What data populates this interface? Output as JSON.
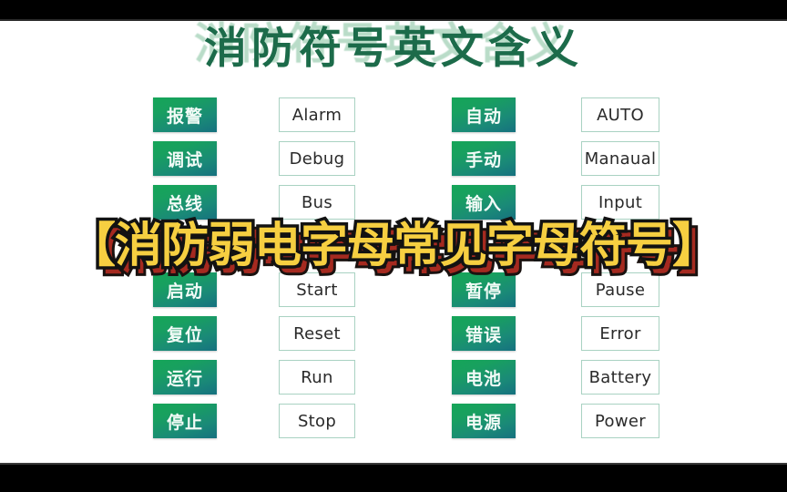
{
  "slide": {
    "title": "消防符号英文含义",
    "background_color": "#ffffff",
    "title_color": "#1c6b4a",
    "title_echo_color": "#b9dcc8",
    "chip_gradient_start": "#15a558",
    "chip_gradient_end": "#16717f",
    "chip_text_color": "#f2fbf7",
    "box_border_color": "#a9d2c2",
    "box_text_color": "#2a2a2a"
  },
  "columns": [
    {
      "id": "left",
      "rows": [
        {
          "cn": "报警",
          "en": "Alarm"
        },
        {
          "cn": "调试",
          "en": "Debug"
        },
        {
          "cn": "总线",
          "en": "Bus"
        },
        {
          "cn": "",
          "en": ""
        },
        {
          "cn": "启动",
          "en": "Start"
        },
        {
          "cn": "复位",
          "en": "Reset"
        },
        {
          "cn": "运行",
          "en": "Run"
        },
        {
          "cn": "停止",
          "en": "Stop"
        }
      ]
    },
    {
      "id": "right",
      "rows": [
        {
          "cn": "自动",
          "en": "AUTO"
        },
        {
          "cn": "手动",
          "en": "Manaual"
        },
        {
          "cn": "输入",
          "en": "Input"
        },
        {
          "cn": "",
          "en": ""
        },
        {
          "cn": "暂停",
          "en": "Pause"
        },
        {
          "cn": "错误",
          "en": "Error"
        },
        {
          "cn": "电池",
          "en": "Battery"
        },
        {
          "cn": "电源",
          "en": "Power"
        }
      ]
    }
  ],
  "caption": {
    "text": "【消防弱电字母常见字母符号】",
    "fill_color": "#f6cf41",
    "outline_color": "#121212",
    "shadow_color": "#a52a20"
  },
  "letterbox": {
    "color": "#000000"
  }
}
